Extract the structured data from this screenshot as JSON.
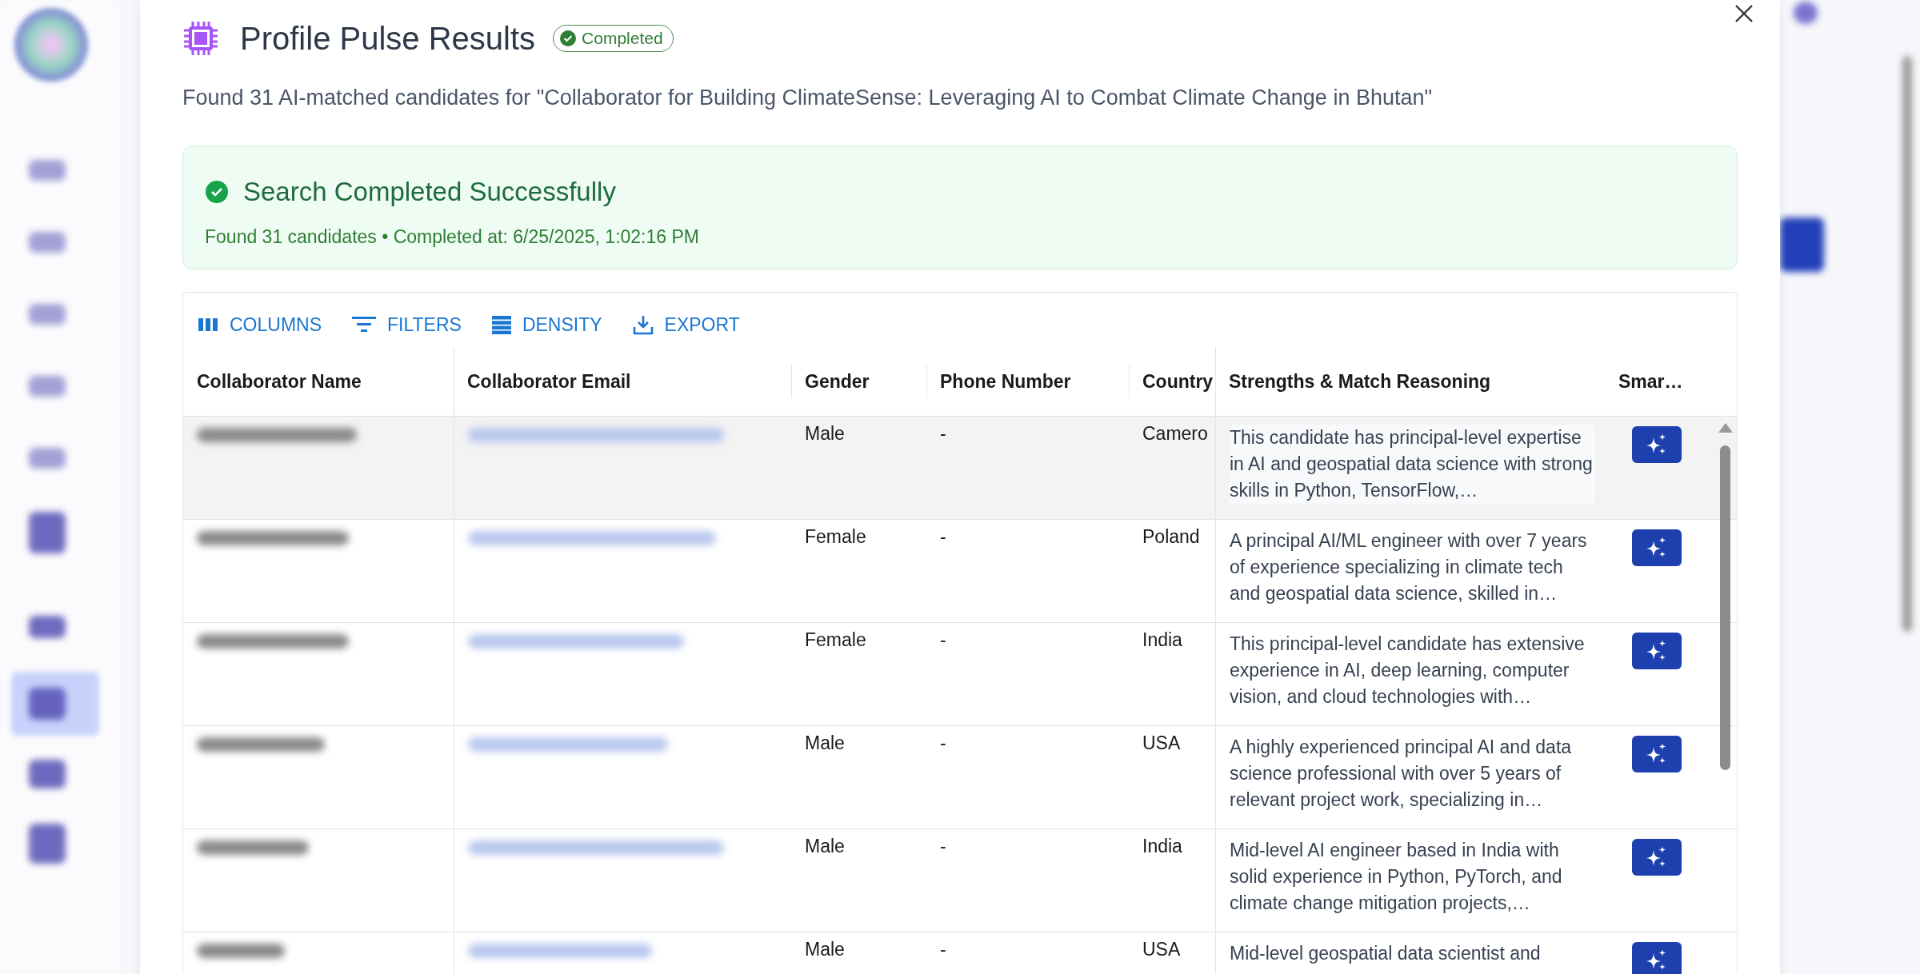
{
  "dialog": {
    "title": "Profile Pulse Results",
    "status_badge": "Completed",
    "summary": "Found 31 AI-matched candidates for \"Collaborator for Building ClimateSense: Leveraging AI to Combat Climate Change in Bhutan\"",
    "alert": {
      "title": "Search Completed Successfully",
      "details": "Found 31 candidates • Completed at: 6/25/2025, 1:02:16 PM"
    },
    "toolbar": [
      {
        "label": "COLUMNS",
        "kind": "columns"
      },
      {
        "label": "FILTERS",
        "kind": "filters"
      },
      {
        "label": "DENSITY",
        "kind": "density"
      },
      {
        "label": "EXPORT",
        "kind": "export"
      }
    ],
    "table": {
      "columns": [
        "Collaborator Name",
        "Collaborator Email",
        "Gender",
        "Phone Number",
        "Country",
        "Strengths & Match Reasoning",
        "Smar…"
      ],
      "rows": [
        {
          "selected": true,
          "gender": "Male",
          "phone": "-",
          "country": "Camero",
          "reasoning": "This candidate has principal-level expertise in AI and geospatial data science with strong skills in Python, TensorFlow,…"
        },
        {
          "selected": false,
          "gender": "Female",
          "phone": "-",
          "country": "Poland",
          "reasoning": "A principal AI/ML engineer with over 7 years of experience specializing in climate tech and geospatial data science, skilled in…"
        },
        {
          "selected": false,
          "gender": "Female",
          "phone": "-",
          "country": "India",
          "reasoning": "This principal-level candidate has extensive experience in AI, deep learning, computer vision, and cloud technologies with…"
        },
        {
          "selected": false,
          "gender": "Male",
          "phone": "-",
          "country": "USA",
          "reasoning": "A highly experienced principal AI and data science professional with over 5 years of relevant project work, specializing in…"
        },
        {
          "selected": false,
          "gender": "Male",
          "phone": "-",
          "country": "India",
          "reasoning": "Mid-level AI engineer based in India with solid experience in Python, PyTorch, and climate change mitigation projects,…"
        },
        {
          "selected": false,
          "gender": "Male",
          "phone": "-",
          "country": "USA",
          "reasoning": "Mid-level geospatial data scientist and"
        }
      ]
    }
  }
}
